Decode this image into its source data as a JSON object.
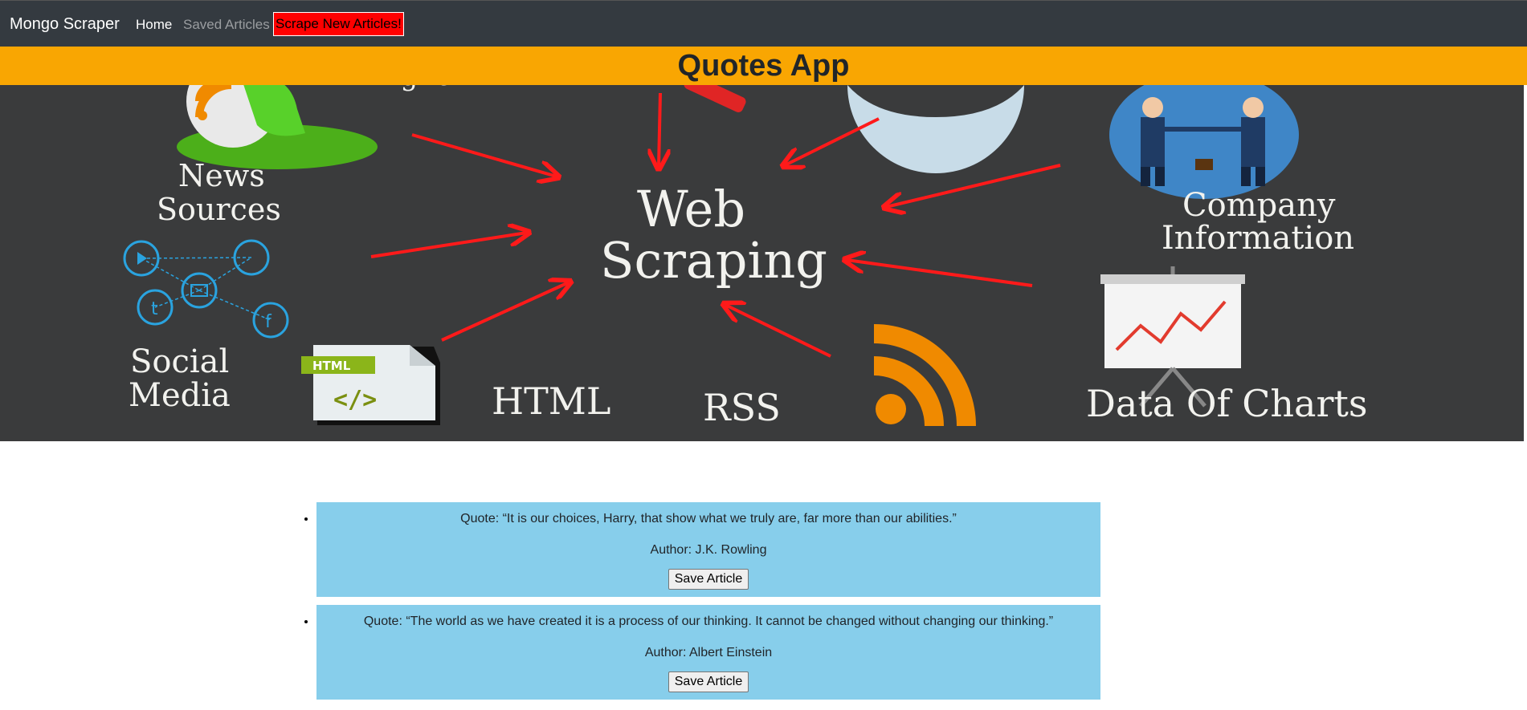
{
  "navbar": {
    "brand": "Mongo Scraper",
    "home_label": "Home",
    "saved_label": "Saved Articles",
    "scrape_label": "Scrape New Articles!"
  },
  "header": {
    "title": "Quotes App"
  },
  "hero": {
    "labels": {
      "news": "News",
      "sources": "Sources",
      "web": "Web",
      "scraping": "Scraping",
      "company": "Company",
      "information": "Information",
      "social": "Social",
      "media": "Media",
      "html_badge": "HTML",
      "html_code": "</>",
      "html": "HTML",
      "rss": "RSS",
      "data_of_charts": "Data Of Charts",
      "partial_top": "Eligne"
    }
  },
  "quotes": [
    {
      "quote_text": "Quote: “It is our choices, Harry, that show what we truly are, far more than our abilities.”",
      "author_text": "Author: J.K. Rowling",
      "button_label": "Save Article"
    },
    {
      "quote_text": "Quote: “The world as we have created it is a process of our thinking. It cannot be changed without changing our thinking.”",
      "author_text": "Author: Albert Einstein",
      "button_label": "Save Article"
    }
  ],
  "colors": {
    "navbar_bg": "#343a40",
    "title_bg": "#f9a602",
    "scrape_button_bg": "#ff0000",
    "card_bg": "#87ceeb",
    "hero_bg": "#3a3b3c",
    "arrow": "#ff1a1a"
  }
}
